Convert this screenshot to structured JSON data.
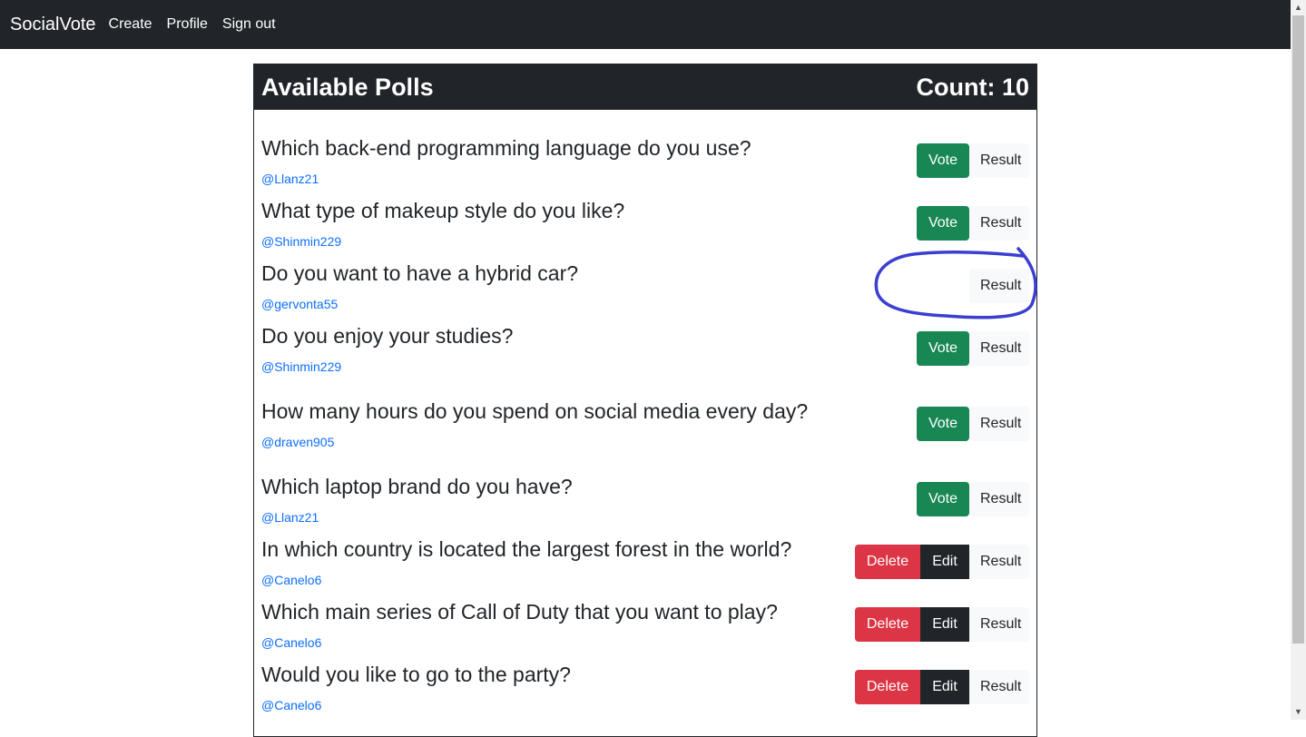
{
  "navbar": {
    "brand": "SocialVote",
    "links": [
      "Create",
      "Profile",
      "Sign out"
    ]
  },
  "header": {
    "title": "Available Polls",
    "count": "Count: 10"
  },
  "buttons": {
    "vote": "Vote",
    "result": "Result",
    "delete": "Delete",
    "edit": "Edit"
  },
  "polls": [
    {
      "question": "Which back-end programming language do you use?",
      "author": "@Llanz21"
    },
    {
      "question": "What type of makeup style do you like?",
      "author": "@Shinmin229"
    },
    {
      "question": "Do you want to have a hybrid car?",
      "author": "@gervonta55"
    },
    {
      "question": "Do you enjoy your studies?",
      "author": "@Shinmin229"
    },
    {
      "question": "How many hours do you spend on social media every day?",
      "author": "@draven905"
    },
    {
      "question": "Which laptop brand do you have?",
      "author": "@Llanz21"
    },
    {
      "question": "In which country is located the largest forest in the world?",
      "author": "@Canelo6"
    },
    {
      "question": "Which main series of Call of Duty that you want to play?",
      "author": "@Canelo6"
    },
    {
      "question": "Would you like to go to the party?",
      "author": "@Canelo6"
    }
  ],
  "colors": {
    "navbar": "#212529",
    "vote": "#198754",
    "delete": "#dc3545",
    "edit": "#212529",
    "author_link": "#0d6efd",
    "annotation": "#3b3fcf"
  }
}
